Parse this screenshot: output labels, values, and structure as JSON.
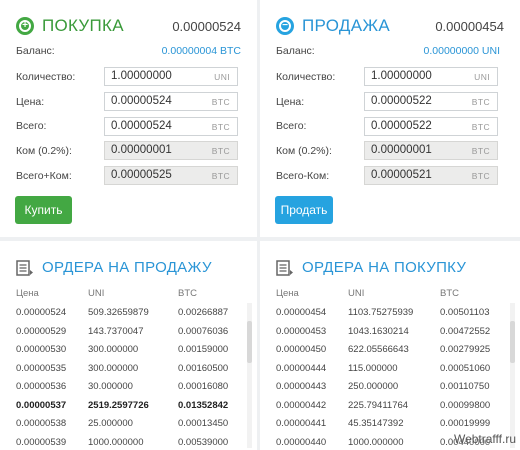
{
  "buy": {
    "title": "ПОКУПКА",
    "price": "0.00000524",
    "balance_label": "Баланс:",
    "balance_value": "0.00000004 BTC",
    "qty_label": "Количество:",
    "qty_value": "1.00000000",
    "qty_cur": "UNI",
    "price_label": "Цена:",
    "price_value": "0.00000524",
    "price_cur": "BTC",
    "total_label": "Всего:",
    "total_value": "0.00000524",
    "total_cur": "BTC",
    "fee_label": "Ком (0.2%):",
    "fee_value": "0.00000001",
    "fee_cur": "BTC",
    "totalfee_label": "Всего+Ком:",
    "totalfee_value": "0.00000525",
    "totalfee_cur": "BTC",
    "button": "Купить",
    "accent": "#43a843"
  },
  "sell": {
    "title": "ПРОДАЖА",
    "price": "0.00000454",
    "balance_label": "Баланс:",
    "balance_value": "0.00000000 UNI",
    "qty_label": "Количество:",
    "qty_value": "1.00000000",
    "qty_cur": "UNI",
    "price_label": "Цена:",
    "price_value": "0.00000522",
    "price_cur": "BTC",
    "total_label": "Всего:",
    "total_value": "0.00000522",
    "total_cur": "BTC",
    "fee_label": "Ком (0.2%):",
    "fee_value": "0.00000001",
    "fee_cur": "BTC",
    "totalfee_label": "Всего-Ком:",
    "totalfee_value": "0.00000521",
    "totalfee_cur": "BTC",
    "button": "Продать",
    "accent": "#26a3e0"
  },
  "sell_orders": {
    "title": "ОРДЕРА НА ПРОДАЖУ",
    "icon": "order-book-icon",
    "headers": [
      "Цена",
      "UNI",
      "BTC"
    ],
    "rows": [
      [
        "0.00000524",
        "509.32659879",
        "0.00266887"
      ],
      [
        "0.00000529",
        "143.7370047",
        "0.00076036"
      ],
      [
        "0.00000530",
        "300.000000",
        "0.00159000"
      ],
      [
        "0.00000535",
        "300.000000",
        "0.00160500"
      ],
      [
        "0.00000536",
        "30.000000",
        "0.00016080"
      ],
      [
        "0.00000537",
        "2519.2597726",
        "0.01352842"
      ],
      [
        "0.00000538",
        "25.000000",
        "0.00013450"
      ],
      [
        "0.00000539",
        "1000.000000",
        "0.00539000"
      ]
    ],
    "bold_row": 5
  },
  "buy_orders": {
    "title": "ОРДЕРА НА ПОКУПКУ",
    "icon": "order-book-icon",
    "headers": [
      "Цена",
      "UNI",
      "BTC"
    ],
    "rows": [
      [
        "0.00000454",
        "1103.75275939",
        "0.00501103"
      ],
      [
        "0.00000453",
        "1043.1630214",
        "0.00472552"
      ],
      [
        "0.00000450",
        "622.05566643",
        "0.00279925"
      ],
      [
        "0.00000444",
        "115.000000",
        "0.00051060"
      ],
      [
        "0.00000443",
        "250.000000",
        "0.00110750"
      ],
      [
        "0.00000442",
        "225.79411764",
        "0.00099800"
      ],
      [
        "0.00000441",
        "45.35147392",
        "0.00019999"
      ],
      [
        "0.00000440",
        "1000.000000",
        "0.00440000"
      ]
    ]
  },
  "watermark": "Webtrafff.ru"
}
